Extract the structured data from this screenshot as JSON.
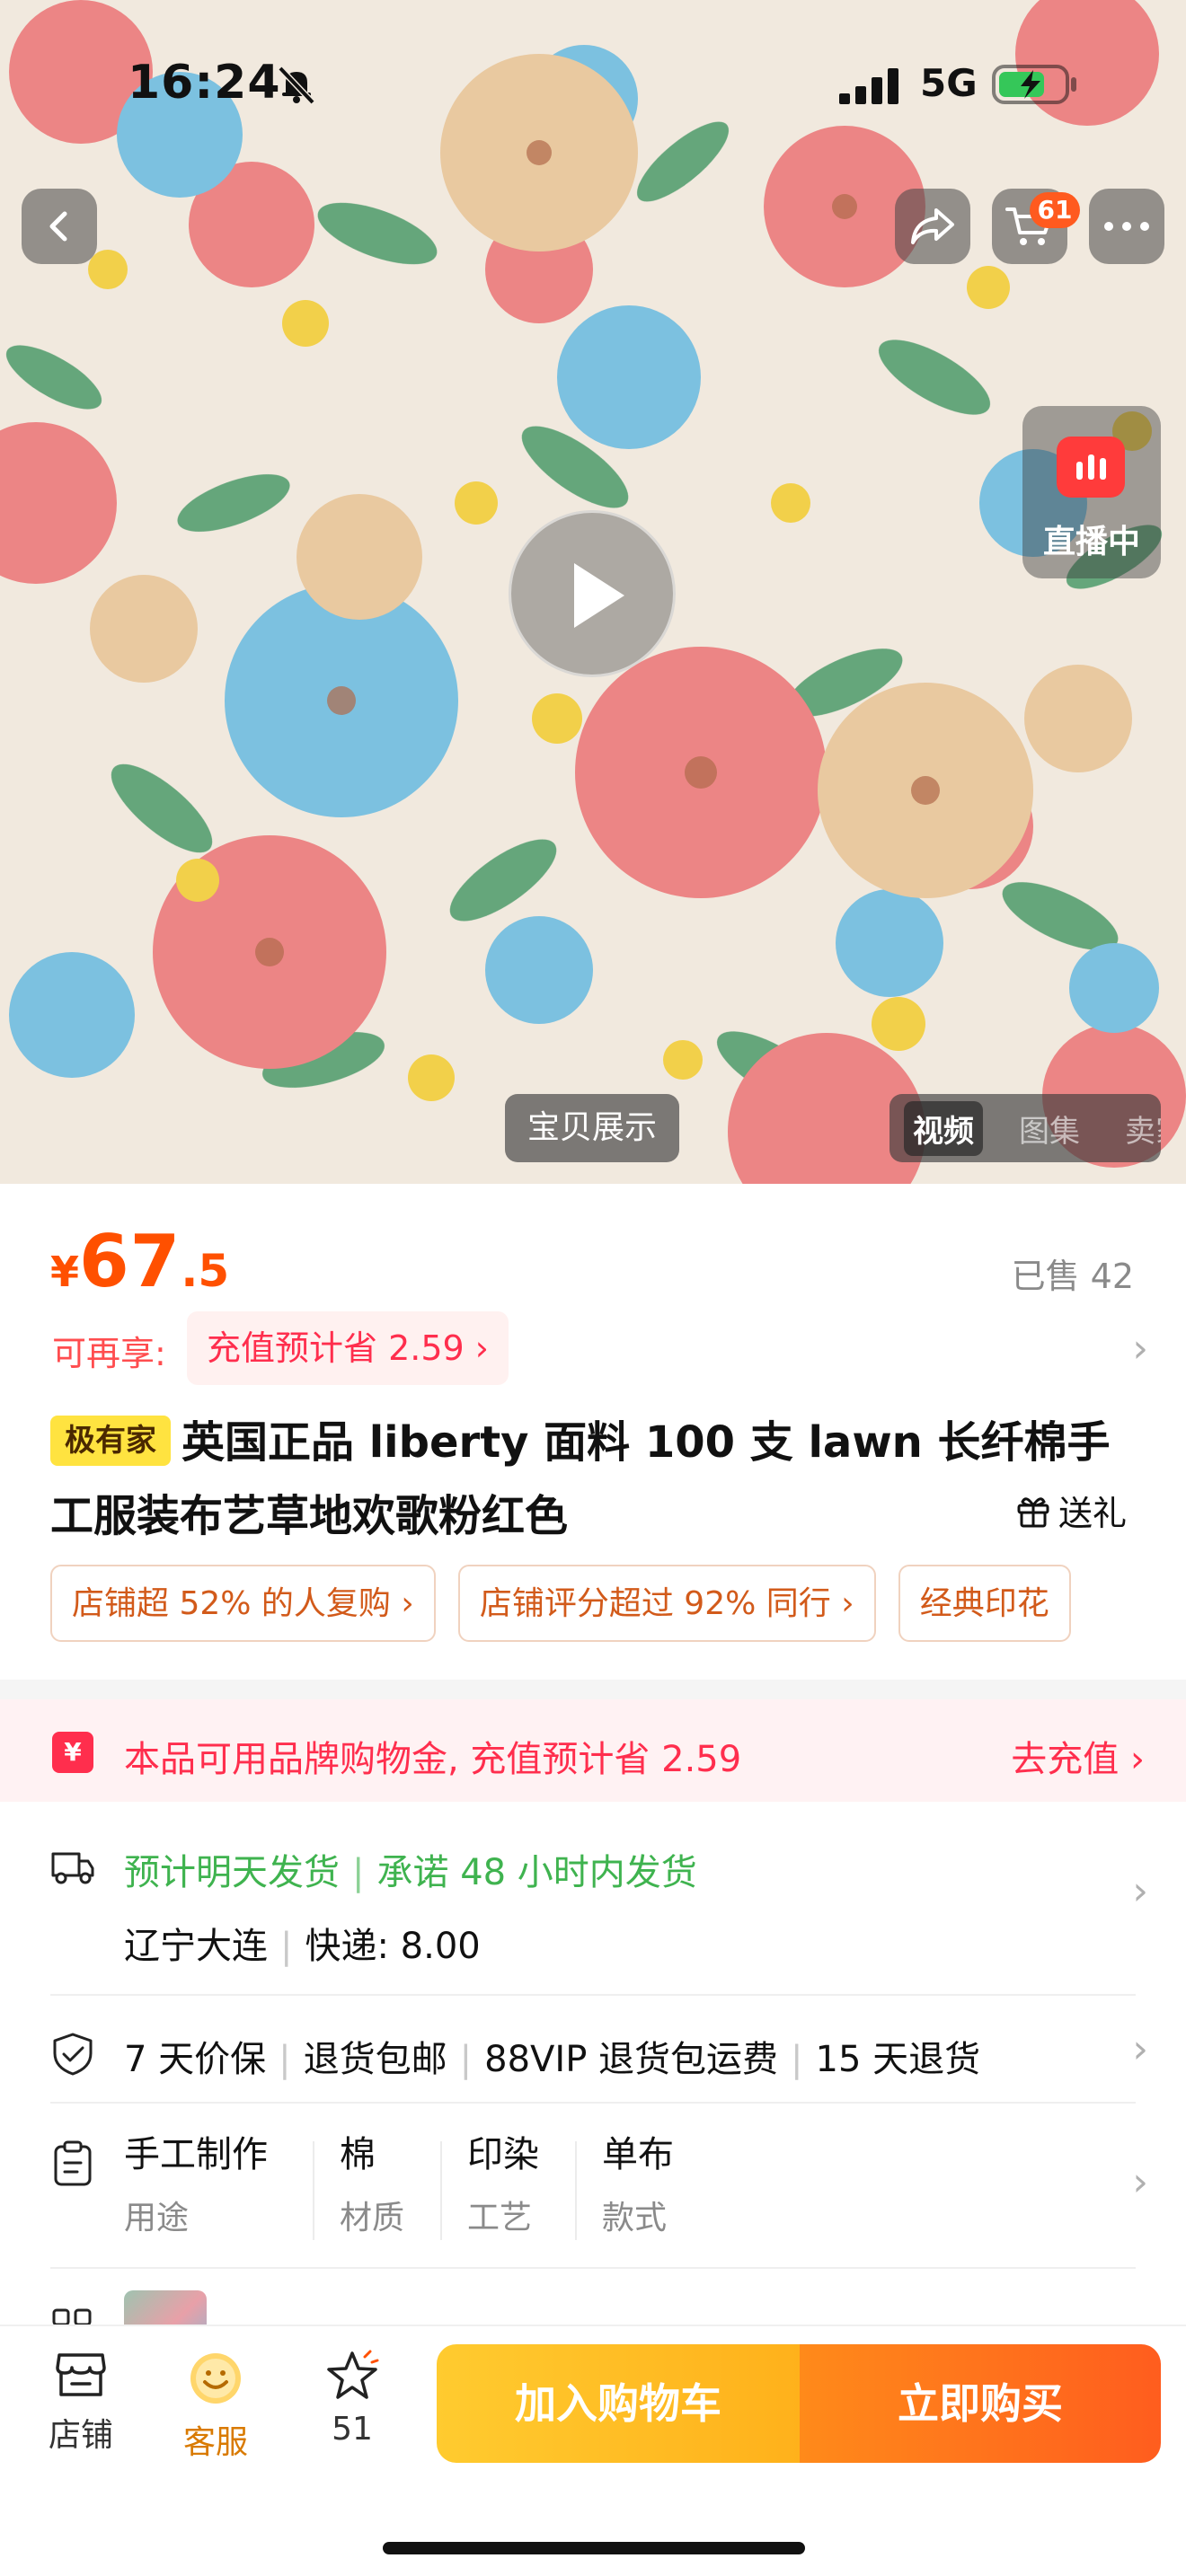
{
  "status_bar": {
    "time": "16:24",
    "network": "5G"
  },
  "header": {
    "cart_count": "61"
  },
  "hero": {
    "live_label": "直播中",
    "gallery_label": "宝贝展示",
    "media_tabs": [
      "视频",
      "图集",
      "卖家"
    ],
    "active_media_tab": "视频"
  },
  "product": {
    "currency": "¥",
    "price_int": "67",
    "price_dec": ".5",
    "sold": "已售 42",
    "benefit_label": "可再享:",
    "benefit_value": "充值预计省 2.59",
    "title_tag": "极有家",
    "title_line1": "英国正品 liberty 面料 100 支 lawn 长纤棉手",
    "title_line2": "工服装布艺草地欢歌粉红色",
    "gift_label": "送礼",
    "chips": [
      "店铺超 52% 的人复购",
      "店铺评分超过 92% 同行",
      "经典印花"
    ]
  },
  "recharge": {
    "text": "本品可用品牌购物金, 充值预计省 2.59",
    "action": "去充值"
  },
  "shipping": {
    "dispatch": "预计明天发货",
    "promise": "承诺 48 小时内发货",
    "location": "辽宁大连",
    "express": "快递: 8.00"
  },
  "guarantees": [
    "7 天价保",
    "退货包邮",
    "88VIP 退货包运费",
    "15 天退货"
  ],
  "params": [
    {
      "value": "手工制作",
      "label": "用途"
    },
    {
      "value": "棉",
      "label": "材质"
    },
    {
      "value": "印染",
      "label": "工艺"
    },
    {
      "value": "单布",
      "label": "款式"
    }
  ],
  "bottom_bar": {
    "shop": "店铺",
    "service": "客服",
    "favorites": "51",
    "add_to_cart": "加入购物车",
    "buy_now": "立即购买"
  },
  "colors": {
    "accent": "#ff5000",
    "recharge": "#ff2e4d",
    "ship_green": "#3fb34f",
    "cart_button": "#ffb11b",
    "buy_button": "#ff5d1e"
  }
}
